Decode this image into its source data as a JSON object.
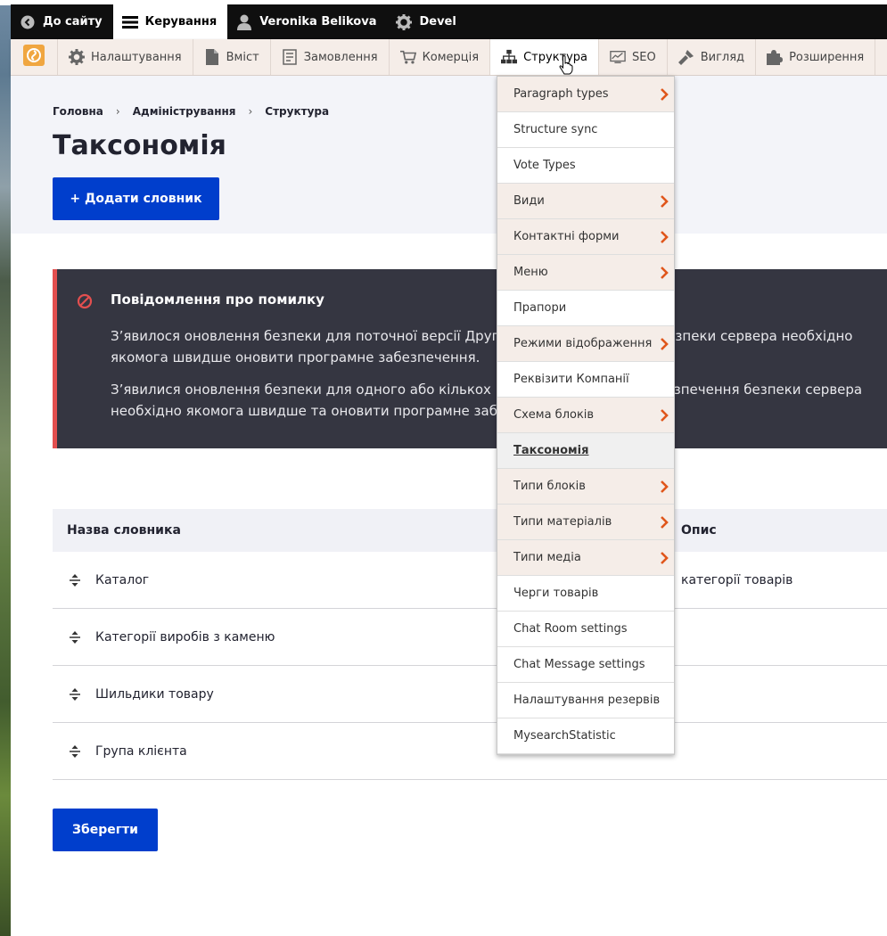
{
  "toolbar": {
    "back_label": "До сайту",
    "manage_label": "Керування",
    "user_label": "Veronika Belikova",
    "devel_label": "Devel"
  },
  "tray": {
    "items": [
      {
        "label": "Налаштування",
        "icon": "gear-icon"
      },
      {
        "label": "Вміст",
        "icon": "document-icon"
      },
      {
        "label": "Замовлення",
        "icon": "orders-icon"
      },
      {
        "label": "Комерція",
        "icon": "cart-icon"
      },
      {
        "label": "Структура",
        "icon": "structure-icon"
      },
      {
        "label": "SEO",
        "icon": "chart-icon"
      },
      {
        "label": "Вигляд",
        "icon": "brush-icon"
      },
      {
        "label": "Розширення",
        "icon": "puzzle-icon"
      }
    ]
  },
  "breadcrumb": {
    "home": "Головна",
    "admin": "Адміністрування",
    "structure": "Структура"
  },
  "page": {
    "title": "Таксономія",
    "add_button": "+ Додати словник",
    "save_button": "Зберегти"
  },
  "message": {
    "title": "Повідомлення про помилку",
    "p1": "З’явилося оновлення безпеки для поточної версії Друпал. Для забезпечення безпеки сервера необхідно якомога швидше оновити програмне забезпечення.",
    "p2": "З’явилися оновлення безпеки для одного або кількох модулів чи тем. Для забезпечення безпеки сервера необхідно якомога швидше та оновити програмне забезпечення."
  },
  "table": {
    "col_name": "Назва словника",
    "col_desc": "Опис",
    "rows": [
      {
        "name": "Каталог",
        "desc": "категорії товарів"
      },
      {
        "name": "Категорії виробів з каменю",
        "desc": ""
      },
      {
        "name": "Шильдики товару",
        "desc": ""
      },
      {
        "name": "Група клієнта",
        "desc": ""
      }
    ]
  },
  "dropdown": {
    "items": [
      {
        "label": "Paragraph types",
        "sub": true
      },
      {
        "label": "Structure sync",
        "sub": false
      },
      {
        "label": "Vote Types",
        "sub": false
      },
      {
        "label": "Види",
        "sub": true
      },
      {
        "label": "Контактні форми",
        "sub": true
      },
      {
        "label": "Меню",
        "sub": true
      },
      {
        "label": "Прапори",
        "sub": false
      },
      {
        "label": "Режими відображення",
        "sub": true
      },
      {
        "label": "Реквізити Компанії",
        "sub": false
      },
      {
        "label": "Схема блоків",
        "sub": true
      },
      {
        "label": "Таксономія",
        "sub": false
      },
      {
        "label": "Типи блоків",
        "sub": true
      },
      {
        "label": "Типи матеріалів",
        "sub": true
      },
      {
        "label": "Типи медіа",
        "sub": true
      },
      {
        "label": "Черги товарів",
        "sub": false
      },
      {
        "label": "Chat Room settings",
        "sub": false
      },
      {
        "label": "Chat Message settings",
        "sub": false
      },
      {
        "label": "Налаштування резервів",
        "sub": false
      },
      {
        "label": "MysearchStatistic",
        "sub": false
      }
    ]
  },
  "colors": {
    "primary": "#003ecc",
    "error_border": "#e34f4f",
    "chevron": "#e0561b",
    "tray_bg": "#f5ede8"
  }
}
